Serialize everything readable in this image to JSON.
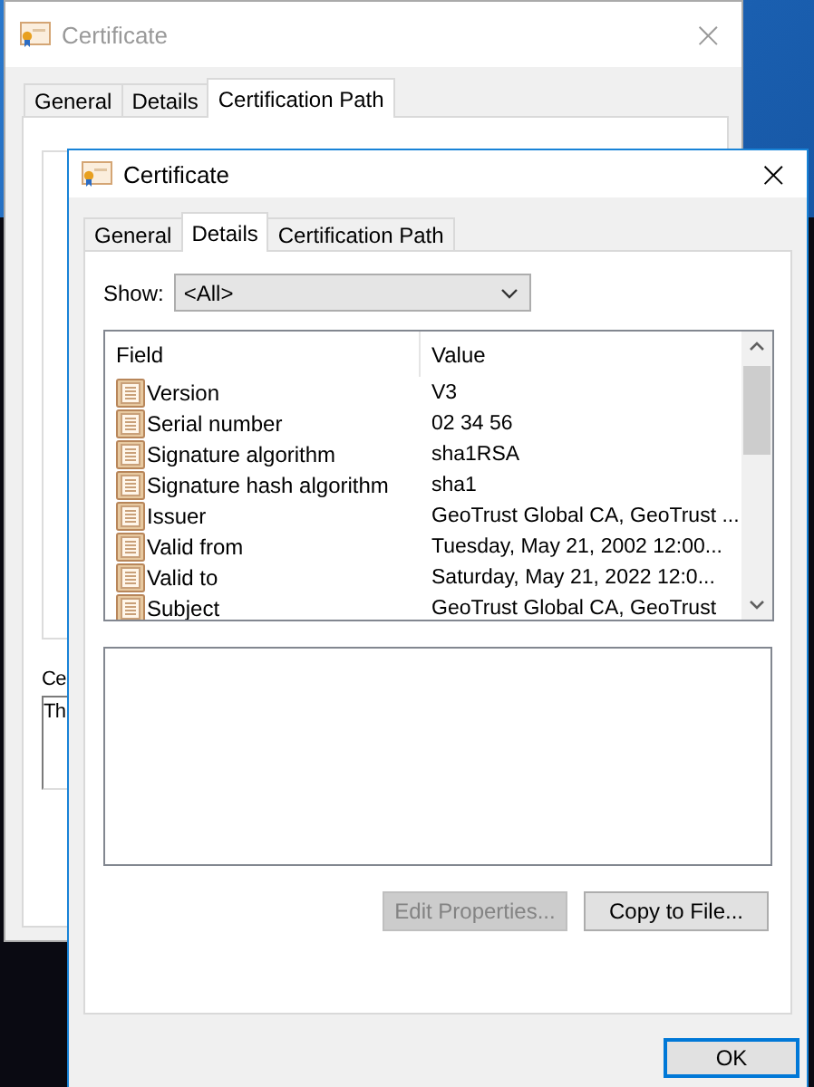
{
  "back_window": {
    "title": "Certificate",
    "active": false,
    "close": "×",
    "tabs": [
      {
        "label": "General",
        "selected": false
      },
      {
        "label": "Details",
        "selected": false
      },
      {
        "label": "Certification Path",
        "selected": true
      }
    ],
    "status_label": "Ce",
    "status_text": "Th"
  },
  "front_window": {
    "title": "Certificate",
    "active": true,
    "close": "×",
    "tabs": [
      {
        "label": "General",
        "selected": false
      },
      {
        "label": "Details",
        "selected": true
      },
      {
        "label": "Certification Path",
        "selected": false
      }
    ],
    "show_label": "Show:",
    "show_value": "<All>",
    "columns": [
      "Field",
      "Value"
    ],
    "rows": [
      {
        "field": "Version",
        "value": "V3"
      },
      {
        "field": "Serial number",
        "value": "02 34 56"
      },
      {
        "field": "Signature algorithm",
        "value": "sha1RSA"
      },
      {
        "field": "Signature hash algorithm",
        "value": "sha1"
      },
      {
        "field": "Issuer",
        "value": "GeoTrust Global CA, GeoTrust ..."
      },
      {
        "field": "Valid from",
        "value": "Tuesday, May 21, 2002 12:00..."
      },
      {
        "field": "Valid to",
        "value": "Saturday, May 21, 2022 12:0..."
      },
      {
        "field": "Subject",
        "value": "GeoTrust Global CA, GeoTrust"
      }
    ],
    "buttons": [
      {
        "label": "Edit Properties...",
        "disabled": true
      },
      {
        "label": "Copy to File...",
        "disabled": false
      }
    ],
    "ok_button": {
      "label": "OK",
      "default": true
    }
  }
}
